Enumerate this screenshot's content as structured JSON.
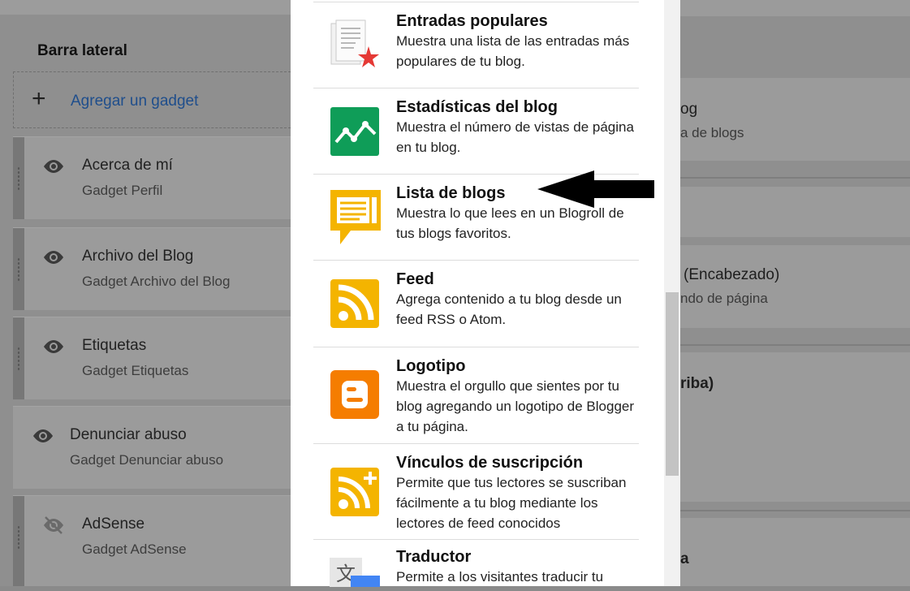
{
  "sidebar": {
    "title": "Barra lateral",
    "add_gadget_label": "Agregar un gadget",
    "gadgets": [
      {
        "name": "Acerca de mí",
        "sub": "Gadget Perfil",
        "visible": true
      },
      {
        "name": "Archivo del Blog",
        "sub": "Gadget Archivo del Blog",
        "visible": true
      },
      {
        "name": "Etiquetas",
        "sub": "Gadget Etiquetas",
        "visible": true
      },
      {
        "name": "Denunciar abuso",
        "sub": "Gadget Denunciar abuso",
        "visible": true
      },
      {
        "name": "AdSense",
        "sub": "Gadget AdSense",
        "visible": false
      }
    ]
  },
  "right_panel": {
    "card1_title": "og",
    "card1_sub": "a de blogs",
    "card2_title": "(Encabezado)",
    "card2_sub": "ndo de página",
    "card3_title": "riba)",
    "card4_title": "a"
  },
  "dialog": {
    "items": [
      {
        "title": "Entradas populares",
        "desc": "Muestra una lista de las entradas más populares de tu blog.",
        "icon": "popular-posts-icon"
      },
      {
        "title": "Estadísticas del blog",
        "desc": "Muestra el número de vistas de página en tu blog.",
        "icon": "stats-icon"
      },
      {
        "title": "Lista de blogs",
        "desc": "Muestra lo que lees en un Blogroll de tus blogs favoritos.",
        "icon": "blog-list-icon"
      },
      {
        "title": "Feed",
        "desc": "Agrega contenido a tu blog desde un feed RSS o Atom.",
        "icon": "feed-icon"
      },
      {
        "title": "Logotipo",
        "desc": "Muestra el orgullo que sientes por tu blog agregando un logotipo de Blogger a tu página.",
        "icon": "blogger-logo-icon"
      },
      {
        "title": "Vínculos de suscripción",
        "desc": "Permite que tus lectores se suscriban fácilmente a tu blog mediante los lectores de feed conocidos",
        "icon": "subscription-links-icon"
      },
      {
        "title": "Traductor",
        "desc": "Permite a los visitantes traducir tu",
        "icon": "translate-icon"
      }
    ]
  },
  "colors": {
    "stats_green": "#0f9d58",
    "feed_yellow": "#f4b400",
    "blogger_orange": "#f57d00",
    "link_blue": "#1a5fb4"
  }
}
